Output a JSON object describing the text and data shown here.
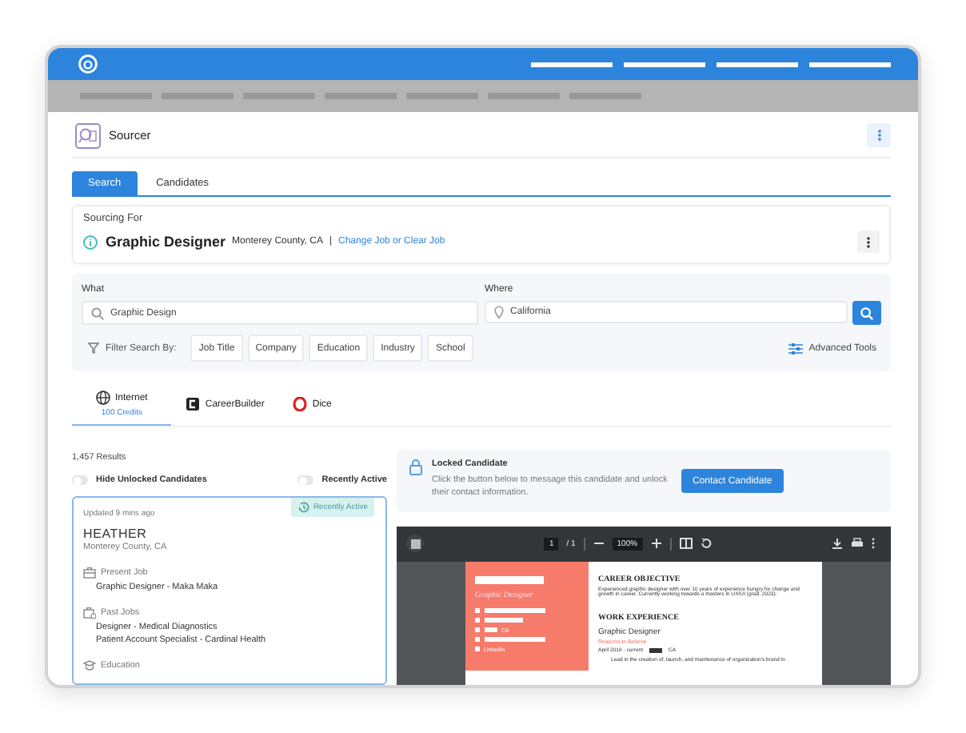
{
  "header": {
    "title": "Sourcer"
  },
  "tabs": [
    {
      "label": "Search",
      "selected": true
    },
    {
      "label": "Candidates",
      "selected": false
    }
  ],
  "sourcing": {
    "heading": "Sourcing For",
    "job_title": "Graphic Designer",
    "location": "Monterey County, CA",
    "separator": "|",
    "link": "Change Job or Clear Job"
  },
  "search": {
    "what_label": "What",
    "what_value": "Graphic Design",
    "where_label": "Where",
    "where_value": "California",
    "filter_label": "Filter Search By:",
    "filters": [
      "Job Title",
      "Company",
      "Education",
      "Industry",
      "School"
    ],
    "advanced": "Advanced Tools"
  },
  "sources": [
    {
      "kind": "globe",
      "name": "Internet",
      "sub": "100 Credits",
      "selected": true
    },
    {
      "kind": "careerbuilder",
      "name": "CareerBuilder",
      "selected": false
    },
    {
      "kind": "dice",
      "name": "Dice",
      "selected": false
    }
  ],
  "results": {
    "count": "1,457 Results",
    "toggles": [
      {
        "label": "Hide Unlocked Candidates",
        "on": false
      },
      {
        "label": "Recently Active",
        "on": false
      }
    ]
  },
  "candidate": {
    "updated": "Updated 9 mins ago",
    "badge": "Recently Active",
    "name": "HEATHER",
    "location": "Monterey County, CA",
    "selected": true,
    "sections": [
      {
        "kind": "present",
        "heading": "Present Job",
        "lines": [
          "Graphic Designer - Maka Maka"
        ]
      },
      {
        "kind": "past",
        "heading": "Past Jobs",
        "lines": [
          "Designer - Medical Diagnostics",
          "Patient Account Specialist - Cardinal Health"
        ]
      },
      {
        "kind": "education",
        "heading": "Education"
      }
    ]
  },
  "locked": {
    "title": "Locked Candidate",
    "message": "Click the button below to message this candidate and unlock their contact information.",
    "button": "Contact Candidate"
  },
  "viewer": {
    "page": "1",
    "pages": "/ 1",
    "zoom": "100%",
    "resume": {
      "role": "Graphic Designer",
      "contacts": [
        {
          "kind": "mail"
        },
        {
          "kind": "phone"
        },
        {
          "kind": "pin",
          "text": "CA"
        },
        {
          "kind": "web"
        },
        {
          "kind": "linkedin",
          "text": "LinkedIn"
        }
      ],
      "objective_heading": "CAREER OBJECTIVE",
      "objective": "Experienced graphic designer with over 10 years of experience hungry for change and growth in career. Currently working towards a masters in UX/UI (grad. 2023).",
      "experience_heading": "WORK EXPERIENCE",
      "job": "Graphic Designer",
      "company": "Reasons to Believe",
      "dates": "April 2018 - current",
      "place": "CA",
      "bullet": "Lead in the creation of, launch, and maintenance of organization's brand in"
    }
  }
}
